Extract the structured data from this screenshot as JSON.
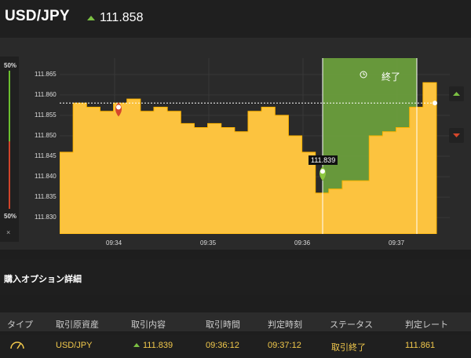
{
  "header": {
    "pair": "USD/JPY",
    "price": "111.858"
  },
  "gauge": {
    "top_label": "50%",
    "bottom_label": "50%",
    "close_symbol": "×"
  },
  "chart": {
    "y_ticks": [
      "111.865",
      "111.860",
      "111.855",
      "111.850",
      "111.845",
      "111.840",
      "111.835",
      "111.830"
    ],
    "x_ticks": [
      "09:34",
      "09:35",
      "09:36",
      "09:37"
    ],
    "expiry_label": "終了",
    "entry_tooltip": "111.839",
    "colors": {
      "fill": "#fcc33f",
      "window": "#6a9e3c",
      "entry_marker": "#8cc63f",
      "high_marker": "#d6472b"
    }
  },
  "chart_data": {
    "type": "area",
    "ylim": [
      111.826,
      111.869
    ],
    "current_price": 111.858,
    "entry_price": 111.839,
    "values": [
      111.846,
      111.858,
      111.857,
      111.856,
      111.858,
      111.859,
      111.856,
      111.857,
      111.856,
      111.853,
      111.852,
      111.853,
      111.852,
      111.851,
      111.856,
      111.857,
      111.855,
      111.85,
      111.846,
      111.836,
      111.837,
      111.839,
      111.839,
      111.85,
      111.851,
      111.852,
      111.857,
      111.863,
      111.858
    ]
  },
  "section": {
    "title": "購入オプション詳細"
  },
  "table": {
    "headers": [
      "タイプ",
      "取引原資産",
      "取引内容",
      "取引時間",
      "判定時刻",
      "ステータス",
      "判定レート"
    ],
    "row": {
      "asset": "USD/JPY",
      "content": "111.839",
      "trade_time": "09:36:12",
      "judge_time": "09:37:12",
      "status": "取引終了",
      "rate": "111.861"
    }
  }
}
